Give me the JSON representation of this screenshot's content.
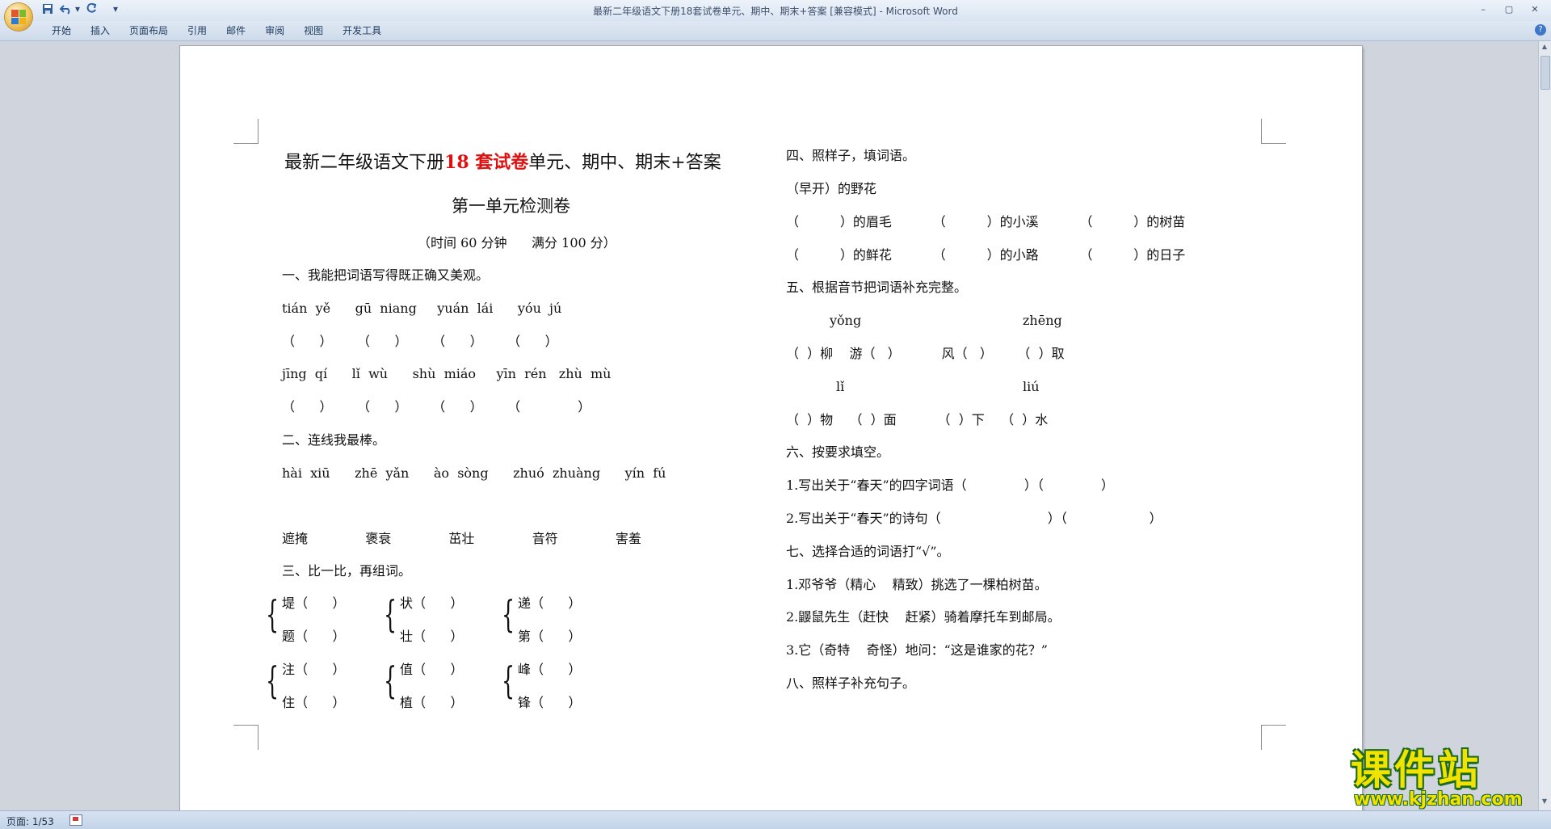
{
  "window": {
    "title": "最新二年级语文下册18套试卷单元、期中、期末+答案 [兼容模式] - Microsoft Word",
    "controls": [
      "–",
      "▢",
      "✕"
    ]
  },
  "quick_access": {
    "save_icon": "save-icon",
    "undo_icon": "undo-icon",
    "redo_icon": "redo-icon",
    "customize": "▾"
  },
  "ribbon_tabs": [
    "开始",
    "插入",
    "页面布局",
    "引用",
    "邮件",
    "审阅",
    "视图",
    "开发工具"
  ],
  "document": {
    "title_prefix": "最新二年级语文下册",
    "title_highlight": "18 套试卷",
    "title_suffix": "单元、期中、期末+答案",
    "subtitle": "第一单元检测卷",
    "time_info": "（时间 60 分钟      满分 100 分）",
    "left": {
      "s1_heading": "一、我能把词语写得既正确又美观。",
      "s1_py1": "tián  yě      gū  niang     yuán  lái      yóu  jú",
      "s1_paren1": "（      ）      （      ）      （      ）      （      ）",
      "s1_py2": "jīng  qí      lǐ  wù      shù  miáo     yīn  rén   zhù  mù",
      "s1_paren2": "（      ）      （      ）      （      ）      （              ）",
      "s2_heading": "二、连线我最棒。",
      "s2_py": "hài  xiū      zhē  yǎn      ào  sòng      zhuó  zhuàng      yín  fú",
      "s2_words": "遮掩              褒衰              茁壮              音符              害羞",
      "s3_heading": "三、比一比，再组词。",
      "s3_rows": [
        [
          "堤（      ）",
          "状（      ）",
          "递（      ）"
        ],
        [
          "题（      ）",
          "壮（      ）",
          "第（      ）"
        ],
        [
          "注（      ）",
          "值（      ）",
          "峰（      ）"
        ],
        [
          "住（      ）",
          "植（      ）",
          "锋（      ）"
        ]
      ]
    },
    "right": {
      "s4_heading": "四、照样子，填词语。",
      "s4_example": "（早开）的野花",
      "s4_row1": "（          ）的眉毛          （          ）的小溪          （          ）的树苗",
      "s4_row2": "（          ）的鲜花          （          ）的小路          （          ）的日子",
      "s5_heading": "五、根据音节把词语补充完整。",
      "s5_py1a": "yǒng",
      "s5_py1b": "zhēng",
      "s5_row1": "（  ）柳    游（   ）          风（   ）      （  ）取",
      "s5_py2a": "lǐ",
      "s5_py2b": "liú",
      "s5_row2": "（  ）物    （  ）面          （  ）下    （  ）水",
      "s6_heading": "六、按要求填空。",
      "s6_q1": "1.写出关于“春天”的四字词语（              ）（              ）",
      "s6_q2": "2.写出关于“春天”的诗句（                          ）（                    ）",
      "s7_heading": "七、选择合适的词语打“√”。",
      "s7_q1": "1.邓爷爷（精心    精致）挑选了一棵柏树苗。",
      "s7_q2": "2.鼹鼠先生（赶快    赶紧）骑着摩托车到邮局。",
      "s7_q3": "3.它（奇特    奇怪）地问：“这是谁家的花？”",
      "s8_heading": "八、照样子补充句子。"
    }
  },
  "status": {
    "page": "页面: 1/53"
  },
  "watermark": {
    "title": "课件站",
    "url": "www.kjzhan.com"
  }
}
